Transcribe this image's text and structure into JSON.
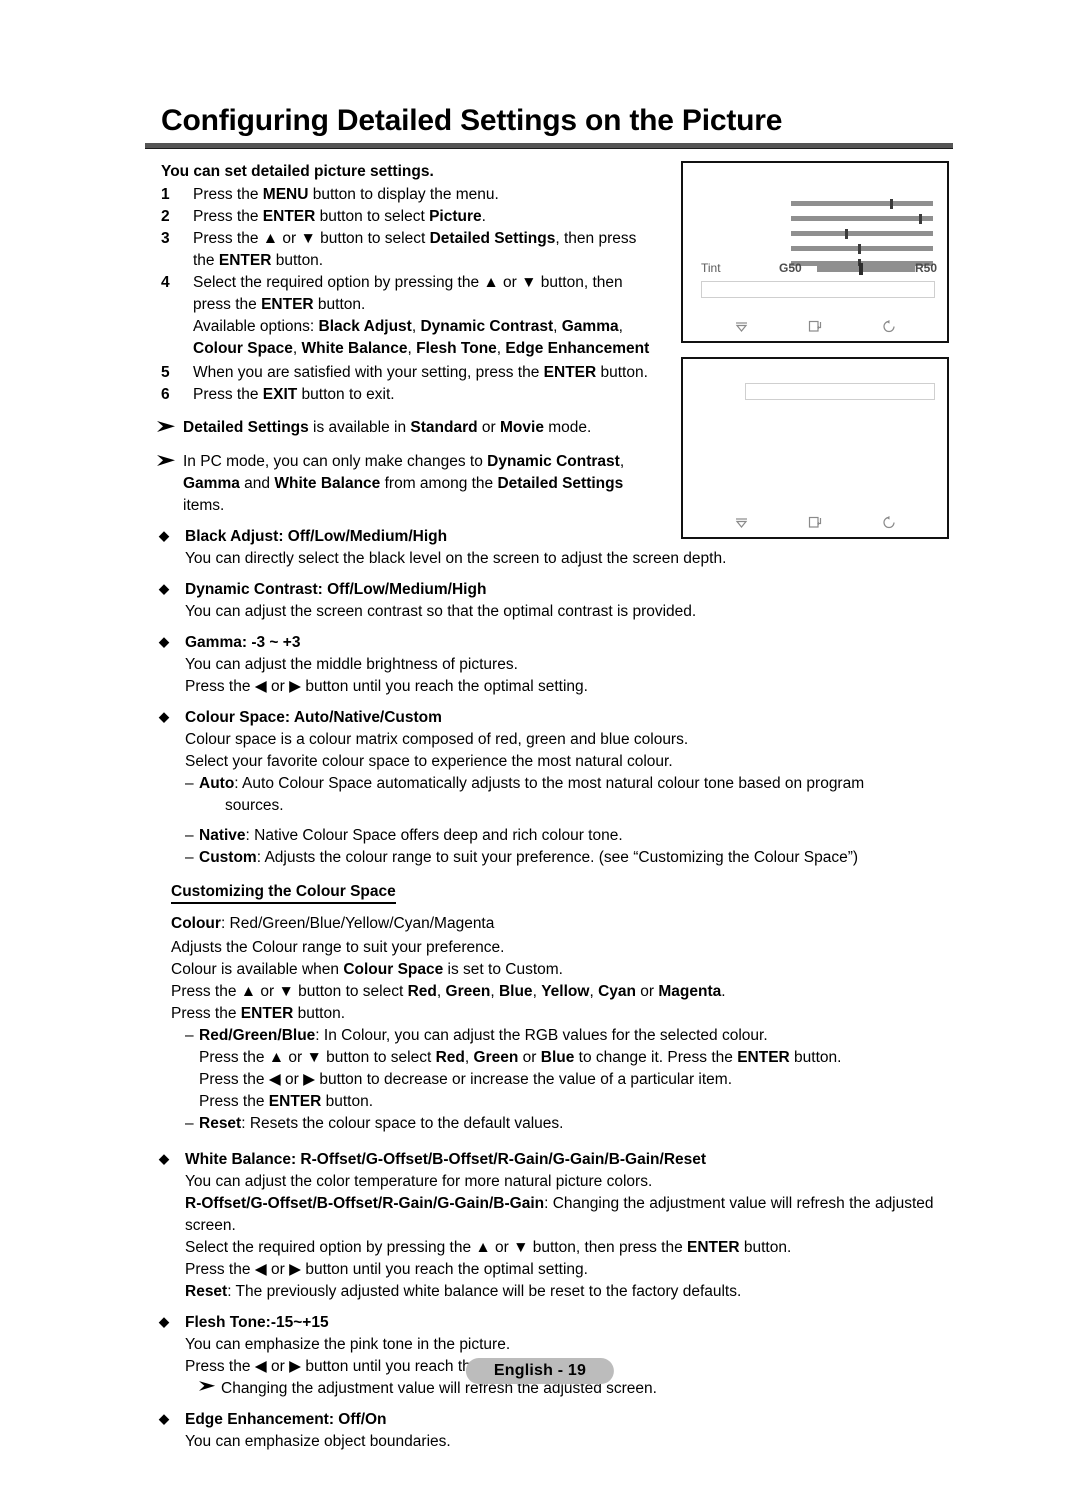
{
  "page": {
    "title": "Configuring Detailed Settings on the Picture",
    "footer_label": "English - 19"
  },
  "intro": {
    "lead": "You can set detailed picture settings."
  },
  "steps": [
    {
      "num": "1",
      "html": "Press the <b>MENU</b> button to display the menu."
    },
    {
      "num": "2",
      "html": "Press the <b>ENTER</b> button to select <b>Picture</b>."
    },
    {
      "num": "3",
      "html": "Press the ▲ or ▼ button to select <b>Detailed Settings</b>, then press the <b>ENTER</b> button."
    },
    {
      "num": "4",
      "html": "Select the required option by pressing the ▲ or ▼ button, then press the <b>ENTER</b> button."
    },
    {
      "num": "5",
      "html": "When you are satisfied with your setting, press the <b>ENTER</b> button."
    },
    {
      "num": "6",
      "html": "Press the <b>EXIT</b> button to exit."
    }
  ],
  "available_options": "Available options: <b>Black Adjust</b>, <b>Dynamic Contrast</b>, <b>Gamma</b>, <b>Colour Space</b>, <b>White Balance</b>, <b>Flesh Tone</b>, <b>Edge Enhancement</b>",
  "notes": [
    "<b>Detailed Settings</b> is available in <b>Standard</b> or <b>Movie</b> mode.",
    "In PC mode, you can only make changes to <b>Dynamic Contrast</b>, <b>Gamma</b> and <b>White Balance</b> from among the <b>Detailed Settings</b> items."
  ],
  "bullets": [
    {
      "heading": "<b>Black Adjust</b>: Off/Low/Medium/High",
      "lines": [
        "You can directly select the black level on the screen to adjust the screen depth."
      ]
    },
    {
      "heading": "<b>Dynamic Contrast</b>: Off/Low/Medium/High",
      "lines": [
        "You can adjust the screen contrast so that the optimal contrast is provided."
      ]
    },
    {
      "heading": "<b>Gamma</b>: -3 ~ +3",
      "lines": [
        "You can adjust the middle brightness of pictures.",
        "Press the ◀ or ▶ button until you reach the optimal setting."
      ]
    },
    {
      "heading": "<b>Colour Space</b>: Auto/Native/Custom",
      "lines": [
        "Colour space is a colour matrix composed of red, green and blue colours.",
        "Select your favorite colour space to experience the most natural colour."
      ],
      "dashes": [
        {
          "html": "<b>Auto</b>: Auto Colour Space automatically adjusts to the most natural colour tone based on program",
          "cont": "sources."
        },
        {
          "html": "<b>Native</b>: Native Colour Space offers deep and rich colour tone."
        },
        {
          "html": "<b>Custom</b>: Adjusts the colour range to suit your preference. (see “Customizing the Colour Space”)"
        }
      ]
    }
  ],
  "custom_section": {
    "title": "Customizing the Colour Space",
    "lines": [
      "<b>Colour</b>: Red/Green/Blue/Yellow/Cyan/Magenta",
      "Adjusts the Colour range to suit your preference.",
      "Colour is available when <b>Colour Space</b> is set to Custom.",
      "Press the ▲ or ▼ button to select <b>Red</b>, <b>Green</b>, <b>Blue</b>, <b>Yellow</b>, <b>Cyan</b> or <b>Magenta</b>.",
      "Press the <b>ENTER</b> button."
    ],
    "dashes": [
      {
        "html": "<b>Red/Green/Blue</b>: In Colour, you can adjust the RGB values for the selected colour.",
        "subs": [
          "Press the ▲ or ▼ button to select <b>Red</b>, <b>Green</b> or <b>Blue</b> to change it. Press the <b>ENTER</b> button.",
          "Press the ◀ or ▶ button to decrease or increase the value of a particular item.",
          "Press the <b>ENTER</b> button."
        ]
      },
      {
        "html": "<b>Reset</b>: Resets the colour space to the default values."
      }
    ]
  },
  "bullets2": [
    {
      "heading": "<b>White Balance</b>: R-Offset/G-Offset/B-Offset/R-Gain/G-Gain/B-Gain/Reset",
      "lines": [
        "You can adjust the color temperature for more natural picture colors.",
        "<b>R-Offset/G-Offset/B-Offset/R-Gain/G-Gain/B-Gain</b>: Changing the adjustment value will refresh the adjusted screen.",
        "Select the required option by pressing the ▲ or ▼ button, then press the <b>ENTER</b> button.",
        "Press the ◀ or ▶ button until you reach the optimal setting.",
        "<b>Reset</b>: The previously adjusted white balance will be reset to the factory defaults."
      ]
    },
    {
      "heading": "<b>Flesh Tone</b>:-15~+15",
      "lines": [
        "You can emphasize the pink tone in the picture.",
        "Press the ◀ or ▶ button until you reach the optimal setting."
      ],
      "note": "Changing the adjustment value will refresh the adjusted screen."
    },
    {
      "heading": "<b>Edge Enhancement</b>: Off/On",
      "lines": [
        "You can emphasize object boundaries."
      ]
    }
  ],
  "tv_screens": [
    {
      "name": "detailed-settings-screen",
      "sliders": [
        {
          "value": 70
        },
        {
          "value": 90
        },
        {
          "value": 38
        },
        {
          "value": 47
        },
        {
          "value": 47
        }
      ],
      "tint": {
        "label": "Tint",
        "left_label": "G50",
        "right_label": "R50",
        "value": 47
      },
      "footer_icons": [
        "move-icon",
        "enter-icon",
        "return-icon"
      ]
    },
    {
      "name": "colour-space-screen",
      "sliders": [],
      "footer_icons": [
        "move-icon",
        "enter-icon",
        "return-icon"
      ]
    }
  ],
  "colors": {
    "rule": "#555555",
    "slider_track": "#8f8f8f",
    "slider_thumb": "#3a3a3a",
    "footer_pill_bg": "#bcbcbc"
  }
}
